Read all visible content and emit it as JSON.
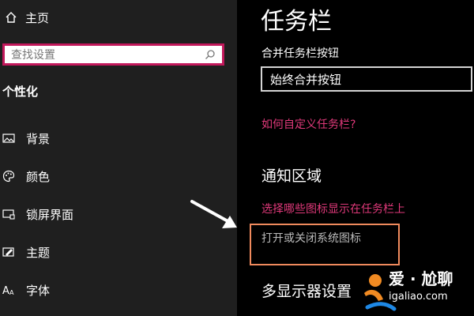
{
  "sidebar": {
    "home_label": "主页",
    "search_placeholder": "查找设置",
    "section_title": "个性化",
    "items": [
      {
        "label": "背景",
        "icon": "image-icon"
      },
      {
        "label": "颜色",
        "icon": "palette-icon"
      },
      {
        "label": "锁屏界面",
        "icon": "lock-screen-icon"
      },
      {
        "label": "主题",
        "icon": "theme-icon"
      },
      {
        "label": "字体",
        "icon": "font-icon"
      }
    ]
  },
  "main": {
    "title": "任务栏",
    "combine_label": "合并任务栏按钮",
    "combine_value": "始终合并按钮",
    "customize_link": "如何自定义任务栏?",
    "notification_heading": "通知区域",
    "select_icons_link": "选择哪些图标显示在任务栏上",
    "system_icons_link": "打开或关闭系统图标",
    "multi_display_heading": "多显示器设置"
  },
  "watermark": {
    "line1": "爱 · 尬聊",
    "line2": "igaliao.com"
  },
  "colors": {
    "accent": "#e0397a",
    "highlight_border": "#f08a5d",
    "sidebar_bg": "#1f1f1f",
    "main_bg": "#000000"
  }
}
